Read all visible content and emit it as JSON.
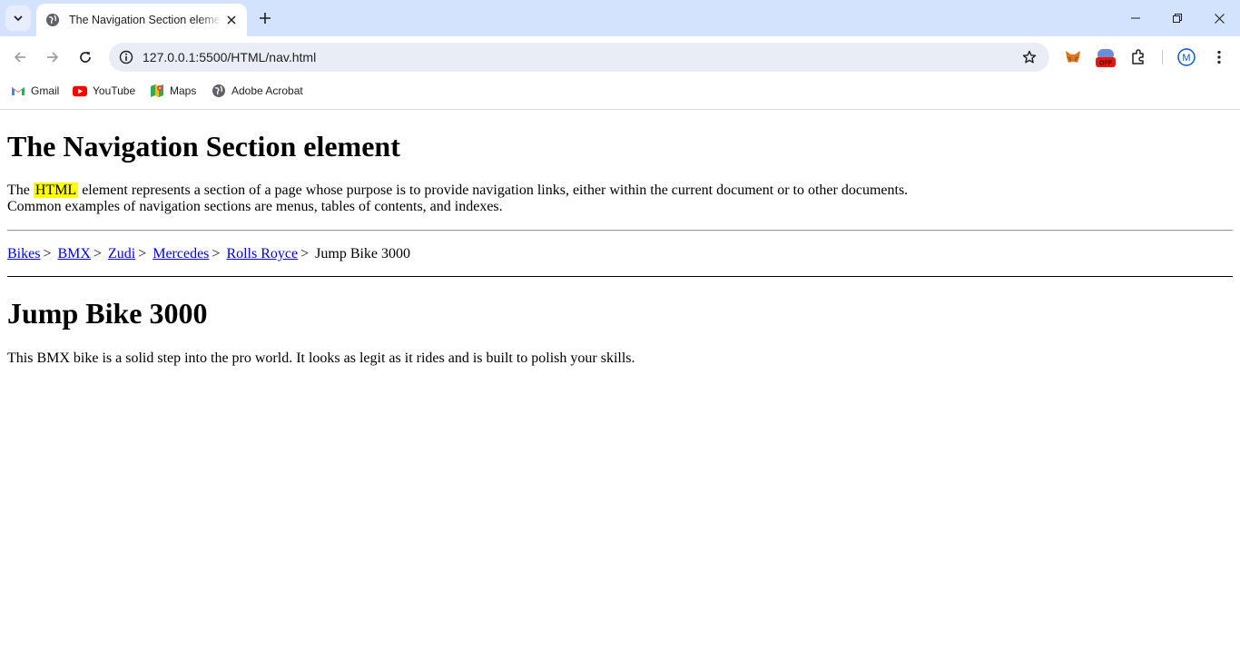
{
  "browser": {
    "tab_title": "The Navigation Section element",
    "url": "127.0.0.1:5500/HTML/nav.html",
    "bookmarks": [
      "Gmail",
      "YouTube",
      "Maps",
      "Adobe Acrobat"
    ],
    "extension_badge": "OFF",
    "profile_initial": "M",
    "colors": {
      "tabstrip": "#d3e3fd",
      "omnibox": "#e9eef6",
      "accent": "#0b57d0"
    }
  },
  "page": {
    "title": "The Navigation Section element",
    "intro_before": "The ",
    "intro_highlight": "HTML",
    "intro_after": " element represents a section of a page whose purpose is to provide navigation links, either within the current document or to other documents.",
    "intro_line2": "Common examples of navigation sections are menus, tables of contents, and indexes.",
    "breadcrumb_links": [
      "Bikes",
      "BMX",
      "Zudi",
      "Mercedes",
      "Rolls Royce"
    ],
    "breadcrumb_separator": ">",
    "breadcrumb_current": "Jump Bike 3000",
    "product_title": "Jump Bike 3000",
    "product_description": "This BMX bike is a solid step into the pro world. It looks as legit as it rides and is built to polish your skills.",
    "highlight_color": "#ffff00",
    "link_color": "#0000ee"
  }
}
